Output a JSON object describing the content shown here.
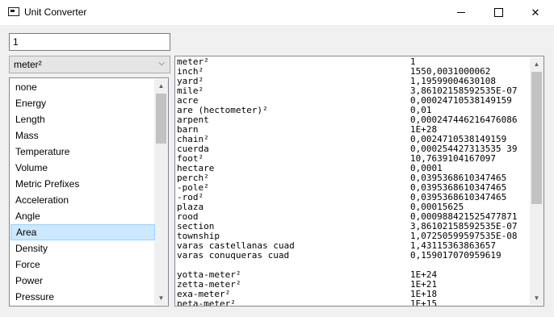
{
  "window": {
    "title": "Unit Converter"
  },
  "input": {
    "value": "1"
  },
  "unit_select": {
    "selected": "meter²"
  },
  "categories": [
    {
      "label": "none"
    },
    {
      "label": "Energy"
    },
    {
      "label": "Length"
    },
    {
      "label": "Mass"
    },
    {
      "label": "Temperature"
    },
    {
      "label": "Volume"
    },
    {
      "label": "Metric Prefixes"
    },
    {
      "label": "Acceleration"
    },
    {
      "label": "Angle"
    },
    {
      "label": "Area"
    },
    {
      "label": "Density"
    },
    {
      "label": "Force"
    },
    {
      "label": "Power"
    },
    {
      "label": "Pressure"
    }
  ],
  "selected_category": "Area",
  "results": [
    {
      "name": "meter²",
      "value": "1"
    },
    {
      "name": "inch²",
      "value": "1550,0031000062"
    },
    {
      "name": "yard²",
      "value": "1,19599004630108"
    },
    {
      "name": "mile²",
      "value": "3,86102158592535E-07"
    },
    {
      "name": "acre",
      "value": "0,00024710538149159"
    },
    {
      "name": "are (hectometer)²",
      "value": "0,01"
    },
    {
      "name": "arpent",
      "value": "0,000247446216476086"
    },
    {
      "name": "barn",
      "value": "1E+28"
    },
    {
      "name": "chain²",
      "value": "0,0024710538149159"
    },
    {
      "name": "cuerda",
      "value": "0,000254427313535 39"
    },
    {
      "name": "foot²",
      "value": "10,7639104167097"
    },
    {
      "name": "hectare",
      "value": "0,0001"
    },
    {
      "name": "perch²",
      "value": "0,0395368610347465"
    },
    {
      "name": "-pole²",
      "value": "0,0395368610347465"
    },
    {
      "name": "-rod²",
      "value": "0,0395368610347465"
    },
    {
      "name": "plaza",
      "value": "0,00015625"
    },
    {
      "name": "rood",
      "value": "0,000988421525477871"
    },
    {
      "name": "section",
      "value": "3,86102158592535E-07"
    },
    {
      "name": "township",
      "value": "1,07250599597535E-08"
    },
    {
      "name": "varas castellanas cuad",
      "value": "1,43115363863657"
    },
    {
      "name": "varas conuqueras cuad",
      "value": "0,159017070959619"
    },
    {
      "name": "",
      "value": ""
    },
    {
      "name": "yotta-meter²",
      "value": "1E+24"
    },
    {
      "name": "zetta-meter²",
      "value": "1E+21"
    },
    {
      "name": "exa-meter²",
      "value": "1E+18"
    },
    {
      "name": "peta-meter²",
      "value": "1E+15"
    }
  ]
}
